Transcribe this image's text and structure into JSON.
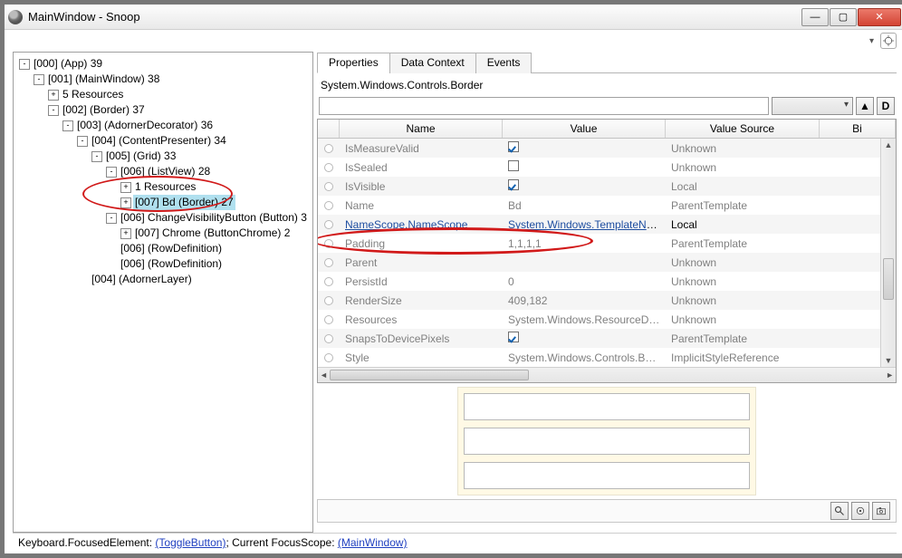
{
  "window": {
    "title": "MainWindow - Snoop"
  },
  "tree": [
    {
      "indent": 0,
      "exp": "-",
      "text": "[000]  (App) 39"
    },
    {
      "indent": 1,
      "exp": "-",
      "text": "[001]  (MainWindow) 38"
    },
    {
      "indent": 2,
      "exp": "+",
      "text": "5 Resources"
    },
    {
      "indent": 2,
      "exp": "-",
      "text": "[002]  (Border) 37"
    },
    {
      "indent": 3,
      "exp": "-",
      "text": "[003]  (AdornerDecorator) 36"
    },
    {
      "indent": 4,
      "exp": "-",
      "text": "[004]  (ContentPresenter) 34"
    },
    {
      "indent": 5,
      "exp": "-",
      "text": "[005]  (Grid) 33"
    },
    {
      "indent": 6,
      "exp": "-",
      "text": "[006]  (ListView) 28"
    },
    {
      "indent": 7,
      "exp": "+",
      "text": "1 Resources"
    },
    {
      "indent": 7,
      "exp": "+",
      "text": "[007] Bd (Border) 27",
      "selected": true
    },
    {
      "indent": 6,
      "exp": "-",
      "text": "[006] ChangeVisibilityButton (Button) 3"
    },
    {
      "indent": 7,
      "exp": "+",
      "text": "[007] Chrome (ButtonChrome) 2"
    },
    {
      "indent": 6,
      "exp": "",
      "text": "[006]  (RowDefinition)"
    },
    {
      "indent": 6,
      "exp": "",
      "text": "[006]  (RowDefinition)"
    },
    {
      "indent": 4,
      "exp": "",
      "text": "[004]  (AdornerLayer)"
    }
  ],
  "tabs": {
    "items": [
      "Properties",
      "Data Context",
      "Events"
    ],
    "active": 0
  },
  "typeLine": "System.Windows.Controls.Border",
  "headers": [
    "",
    "Name",
    "Value",
    "Value Source",
    "Bi"
  ],
  "filterButtons": {
    "up": "▲",
    "d": "D"
  },
  "rows": [
    {
      "dim": true,
      "name": "IsMeasureValid",
      "value": "__check__",
      "src": "Unknown"
    },
    {
      "dim": true,
      "name": "IsSealed",
      "value": "__box__",
      "src": "Unknown"
    },
    {
      "dim": true,
      "name": "IsVisible",
      "value": "__check__",
      "src": "Local"
    },
    {
      "dim": true,
      "name": "Name",
      "value": "Bd",
      "src": "ParentTemplate"
    },
    {
      "link": true,
      "name": "NameScope.NameScope",
      "value": "System.Windows.TemplateNam",
      "src": "Local"
    },
    {
      "dim": true,
      "name": "Padding",
      "value": "1,1,1,1",
      "src": "ParentTemplate"
    },
    {
      "dim": true,
      "name": "Parent",
      "value": "",
      "src": "Unknown"
    },
    {
      "dim": true,
      "name": "PersistId",
      "value": "0",
      "src": "Unknown"
    },
    {
      "dim": true,
      "name": "RenderSize",
      "value": "409,182",
      "src": "Unknown"
    },
    {
      "dim": true,
      "name": "Resources",
      "value": "System.Windows.ResourceDicti",
      "src": "Unknown"
    },
    {
      "dim": true,
      "name": "SnapsToDevicePixels",
      "value": "__check__",
      "src": "ParentTemplate"
    },
    {
      "dim": true,
      "name": "Style",
      "value": "System.Windows.Controls.Bord",
      "src": "ImplicitStyleReference"
    }
  ],
  "bottomIcons": [
    "search-icon",
    "target-icon",
    "camera-icon"
  ],
  "status": {
    "prefix": "Keyboard.FocusedElement: ",
    "link1": "(ToggleButton)",
    "mid": "; Current FocusScope: ",
    "link2": "(MainWindow)"
  }
}
